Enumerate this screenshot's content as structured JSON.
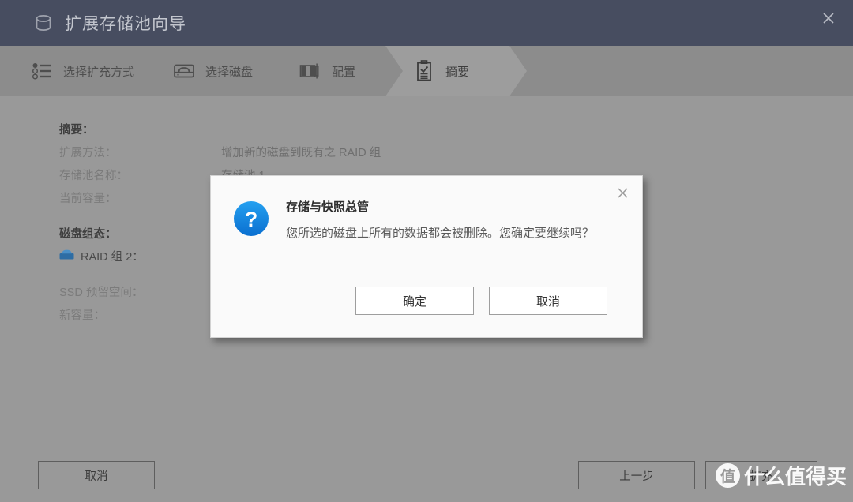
{
  "window": {
    "title": "扩展存储池向导",
    "title_icon": "storage-pool-cylinder-icon",
    "close_label": "✕",
    "colors": {
      "titlebar_bg": "#474d60",
      "stepbar_bg": "#8c8c8c",
      "content_bg": "#999999",
      "accent_blue": "#1186e0"
    }
  },
  "steps": [
    {
      "label": "选择扩充方式",
      "icon": "bullet-list-icon",
      "active": false
    },
    {
      "label": "选择磁盘",
      "icon": "hard-disk-icon",
      "active": false
    },
    {
      "label": "配置",
      "icon": "partition-bars-icon",
      "active": false
    },
    {
      "label": "摘要",
      "icon": "clipboard-check-icon",
      "active": true
    }
  ],
  "summary": {
    "heading": "摘要：",
    "rows": [
      {
        "label": "扩展方法：",
        "value": "增加新的磁盘到既有之 RAID 组"
      },
      {
        "label": "存储池名称：",
        "value": "存储池 1"
      },
      {
        "label": "当前容量：",
        "value": ""
      }
    ],
    "disk_config_heading": "磁盘组态：",
    "raid_group": {
      "icon": "blue-hard-disk-icon",
      "label": "RAID 组 2："
    },
    "tail_rows": [
      {
        "label": "SSD 预留空间：",
        "value": ""
      },
      {
        "label": "新容量：",
        "value": ""
      }
    ]
  },
  "footer": {
    "cancel": "取消",
    "previous": "上一步",
    "expand": "扩充"
  },
  "dialog": {
    "title": "存储与快照总管",
    "message": "您所选的磁盘上所有的数据都会被删除。您确定要继续吗？",
    "icon": "question-mark-circle-icon",
    "close_label": "✕",
    "confirm": "确定",
    "cancel": "取消"
  },
  "watermark": {
    "badge": "值",
    "text": "什么值得买"
  }
}
